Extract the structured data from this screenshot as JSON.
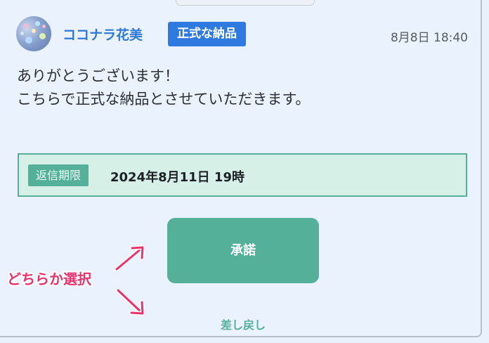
{
  "message": {
    "sender": "ココナラ花美",
    "badge": "正式な納品",
    "timestamp": "8月8日 18:40",
    "lines": [
      "ありがとうございます！",
      "こちらで正式な納品とさせていただきます。"
    ]
  },
  "deadline": {
    "label": "返信期限",
    "value": "2024年8月11日 19時"
  },
  "actions": {
    "accept_label": "承諾",
    "return_label": "差し戻し"
  },
  "annotation": {
    "text": "どちらか選択"
  },
  "colors": {
    "accent": "#2f7ae0",
    "green": "#55b09a",
    "annotation": "#e8336d",
    "background": "#eaf2fd"
  },
  "icons": {
    "arrow": "arrow-icon"
  }
}
